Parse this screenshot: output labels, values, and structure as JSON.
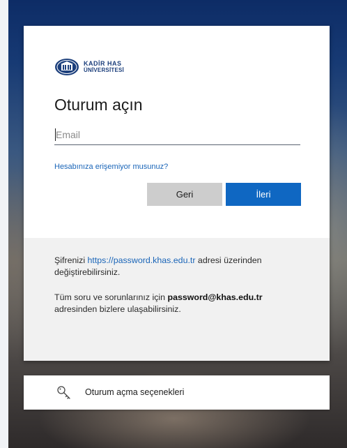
{
  "brand": {
    "line1": "KADİR HAS",
    "line2": "ÜNİVERSİTESİ",
    "color": "#1c3f7c",
    "icon": "university-seal"
  },
  "signin": {
    "title": "Oturum açın",
    "email_placeholder": "Email",
    "email_value": "",
    "recover_link": "Hesabınıza erişemiyor musunuz?",
    "back_label": "Geri",
    "next_label": "İleri",
    "accent": "#0f67c2"
  },
  "info": {
    "p1_prefix": "Şifrenizi ",
    "p1_link": "https://password.khas.edu.tr",
    "p1_suffix": " adresi üzerinden değiştirebilirsiniz.",
    "p2_prefix": "Tüm soru ve sorunlarınız için ",
    "p2_email": "password@khas.edu.tr",
    "p2_suffix": " adresinden bizlere ulaşabilirsiniz."
  },
  "signin_options": {
    "label": "Oturum açma seçenekleri",
    "icon": "key-icon"
  }
}
